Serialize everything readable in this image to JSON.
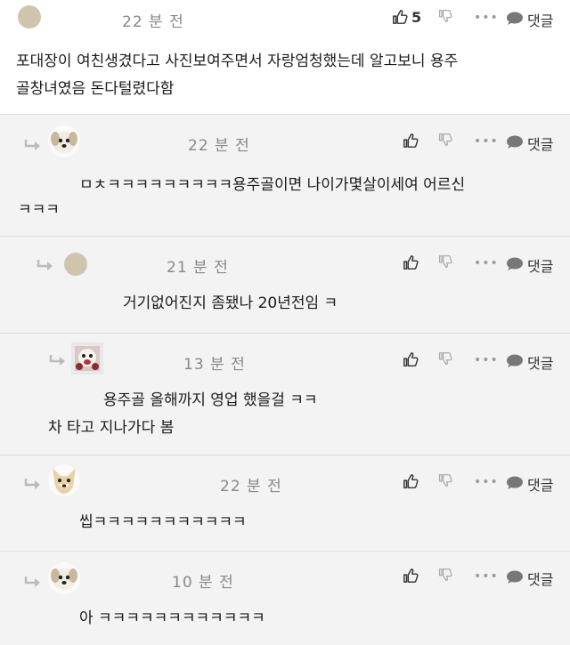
{
  "comments": [
    {
      "time": "22 분 전",
      "likes": "5",
      "reply_label": "댓글",
      "lines": [
        "포대장이 여친생겼다고 사진보여주면서 자랑엄청했는데 알고보니 용주",
        "골창녀였음 돈다털렸다함"
      ]
    },
    {
      "time": "22 분 전",
      "reply_label": "댓글",
      "lines": [
        "ㅁㅊㅋㅋㅋㅋㅋㅋㅋㅋㅋ용주골이면 나이가몇살이세여 어르신",
        "ㅋㅋㅋ"
      ]
    },
    {
      "time": "21 분 전",
      "reply_label": "댓글",
      "lines": [
        "거기없어진지 좀됐나 20년전임 ㅋ"
      ]
    },
    {
      "time": "13 분 전",
      "reply_label": "댓글",
      "lines": [
        "용주골 올해까지 영업 했을걸 ㅋㅋ",
        "차 타고 지나가다 봄"
      ]
    },
    {
      "time": "22 분 전",
      "reply_label": "댓글",
      "lines": [
        "씹ㅋㅋㅋㅋㅋㅋㅋㅋㅋㅋㅋ"
      ]
    },
    {
      "time": "10 분 전",
      "reply_label": "댓글",
      "lines": [
        "아 ㅋㅋㅋㅋㅋㅋㅋㅋㅋㅋㅋㅋ"
      ]
    }
  ],
  "icons": {
    "like": "thumb-up-icon",
    "dislike": "thumb-down-icon",
    "more": "more-dots-icon",
    "reply": "speech-bubble-icon",
    "reply_arrow": "reply-arrow-icon"
  }
}
